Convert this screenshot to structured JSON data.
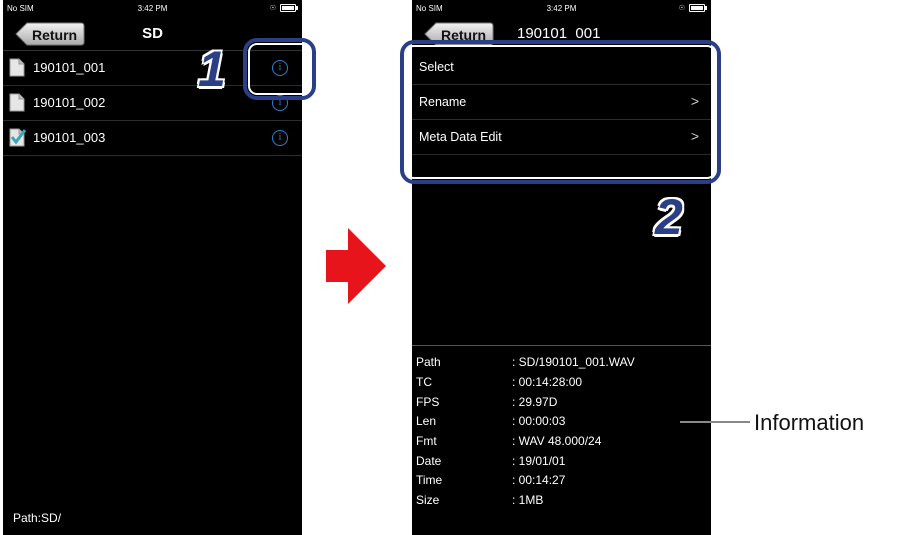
{
  "status_bar": {
    "carrier": "No SIM",
    "time": "3:42 PM"
  },
  "screen1": {
    "return_label": "Return",
    "title": "SD",
    "files": [
      {
        "name": "190101_001",
        "checked": false
      },
      {
        "name": "190101_002",
        "checked": false
      },
      {
        "name": "190101_003",
        "checked": true
      }
    ],
    "path": "Path:SD/",
    "step_number": "1"
  },
  "screen2": {
    "return_label": "Return",
    "title": "190101_001",
    "menu": [
      {
        "label": "Select",
        "chevron": ""
      },
      {
        "label": "Rename",
        "chevron": ">"
      },
      {
        "label": "Meta Data Edit",
        "chevron": ">"
      }
    ],
    "step_number": "2",
    "info": [
      {
        "key": "Path",
        "value": ": SD/190101_001.WAV"
      },
      {
        "key": "TC",
        "value": ": 00:14:28:00"
      },
      {
        "key": "FPS",
        "value": ": 29.97D"
      },
      {
        "key": "Len",
        "value": ": 00:00:03"
      },
      {
        "key": "Fmt",
        "value": ": WAV 48.000/24"
      },
      {
        "key": "Date",
        "value": ": 19/01/01"
      },
      {
        "key": "Time",
        "value": ": 00:14:27"
      },
      {
        "key": "Size",
        "value": ": 1MB"
      }
    ]
  },
  "annotation": {
    "information_label": "Information"
  },
  "colors": {
    "callout": "#2a3f86",
    "arrow": "#e8141b",
    "info_icon": "#2f7fd0"
  },
  "icons": {
    "file": "document-icon",
    "checked_file": "checked-document-icon",
    "info": "info-icon",
    "chevron": "chevron-right-icon"
  }
}
